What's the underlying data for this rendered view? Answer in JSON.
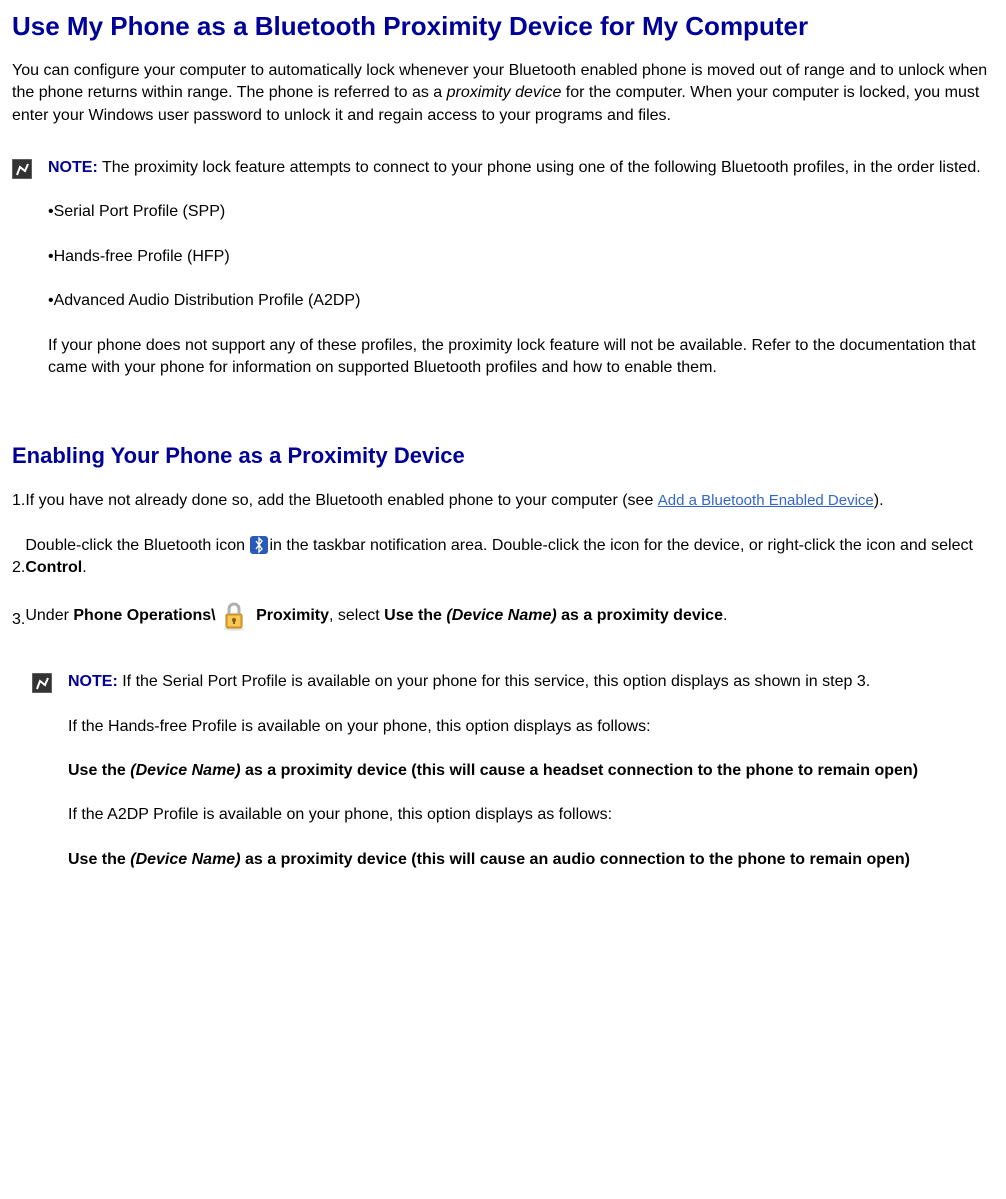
{
  "title": "Use My Phone as a Bluetooth Proximity Device for My Computer",
  "intro": {
    "part1": "You can configure your computer to automatically lock whenever your Bluetooth enabled phone is moved out of range and to unlock when the phone returns within range. The phone is referred to as a ",
    "italic": "proximity device",
    "part2": " for the computer. When your computer is locked, you must enter your Windows user password to unlock it and regain access to your programs and files."
  },
  "note1": {
    "label": "NOTE:",
    "text": " The proximity lock feature attempts to connect to your phone using one of the following Bluetooth profiles, in the order listed.",
    "profiles": [
      "•Serial Port Profile (SPP)",
      "•Hands-free Profile (HFP)",
      "•Advanced Audio Distribution Profile (A2DP)"
    ],
    "footer": "If your phone does not support any of these profiles, the proximity lock feature will not be available. Refer to the documentation that came with your phone for information on supported Bluetooth profiles and how to enable them."
  },
  "section2": {
    "heading": "Enabling Your Phone as a Proximity Device",
    "step1": {
      "num": "1.",
      "text1": "If you have not already done so, add the Bluetooth enabled phone to your computer (see ",
      "link": "Add a Bluetooth Enabled Device",
      "text2": ")."
    },
    "step2": {
      "num": "2.",
      "text1": "Double-click the Bluetooth icon ",
      "text2": "in the taskbar notification area. Double-click the icon for the device, or right-click the icon and select ",
      "bold": "Control",
      "text3": "."
    },
    "step3": {
      "num": "3.",
      "text1": "Under ",
      "bold1": "Phone Operations\\",
      "text2": " ",
      "bold2": "Proximity",
      "text3": ", select ",
      "bold3a": "Use the ",
      "italic1": "(Device Name)",
      "bold3b": " as a proximity device",
      "text4": "."
    }
  },
  "note2": {
    "label": "NOTE:",
    "p1": " If the Serial Port Profile is available on your phone for this service, this option displays as shown in step 3.",
    "p2": "If the Hands-free Profile is available on your phone, this option displays as follows:",
    "p3a": "Use the ",
    "p3italic": "(Device Name)",
    "p3b": " as a proximity device (this will cause a headset connection to the phone to remain open)",
    "p4": "If the A2DP Profile is available on your phone, this option displays as follows:",
    "p5a": "Use the ",
    "p5italic": "(Device Name)",
    "p5b": " as a proximity device (this will cause an audio connection to the phone to remain open)"
  }
}
